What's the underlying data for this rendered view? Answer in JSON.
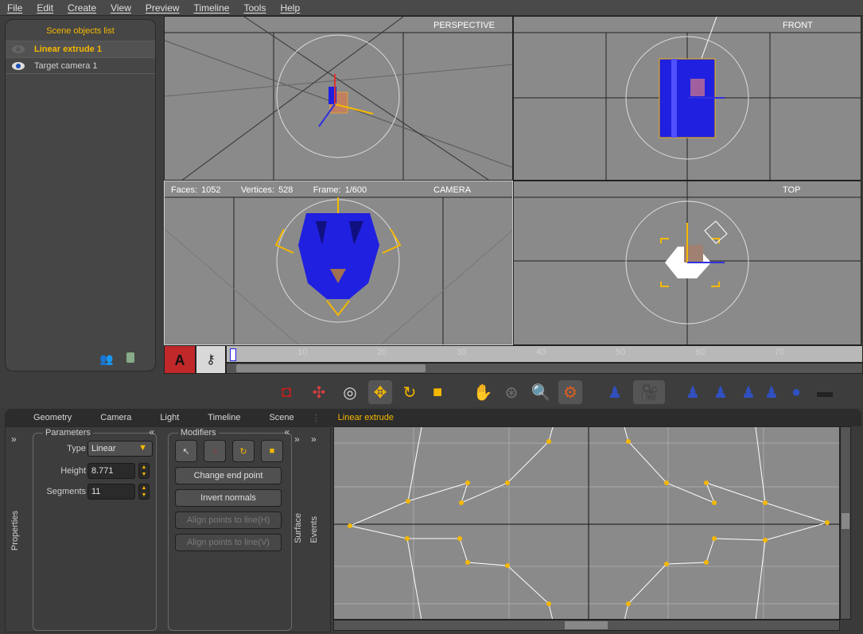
{
  "menu": [
    "File",
    "Edit",
    "Create",
    "View",
    "Preview",
    "Timeline",
    "Tools",
    "Help"
  ],
  "scene_panel": {
    "title": "Scene objects list",
    "objects": [
      {
        "name": "Linear extrude 1",
        "selected": true
      },
      {
        "name": "Target camera 1",
        "selected": false
      }
    ]
  },
  "viewports": {
    "perspective": "PERSPECTIVE",
    "front": "FRONT",
    "camera": "CAMERA",
    "top": "TOP",
    "camera_info": {
      "faces": "Faces: 1052",
      "vertices": "Vertices: 528",
      "frame": "Frame: 1/600"
    }
  },
  "timeline": {
    "ticks": [
      "10",
      "20",
      "30",
      "40",
      "50",
      "60",
      "70"
    ],
    "auto_key_label": "A",
    "key_icon": "key-icon"
  },
  "tabs": [
    {
      "label": "Geometry",
      "active": false
    },
    {
      "label": "Camera",
      "active": false
    },
    {
      "label": "Light",
      "active": false
    },
    {
      "label": "Timeline",
      "active": false
    },
    {
      "label": "Scene",
      "active": false
    },
    {
      "label": "Linear extrude",
      "active": true
    }
  ],
  "parameters": {
    "title": "Parameters",
    "type_label": "Type",
    "type_value": "Linear",
    "height_label": "Height",
    "height_value": "8.771",
    "segments_label": "Segments",
    "segments_value": "11"
  },
  "modifiers": {
    "title": "Modifiers",
    "buttons": [
      {
        "label": "Change end point",
        "enabled": true
      },
      {
        "label": "Invert normals",
        "enabled": true
      },
      {
        "label": "Align points to line(H)",
        "enabled": false
      },
      {
        "label": "Align points to line(V)",
        "enabled": false
      }
    ]
  },
  "side_tabs": {
    "properties": "Properties",
    "surface": "Surface",
    "events": "Events"
  },
  "colors": {
    "accent": "#f5b800",
    "viewport_bg": "#8a8a8a",
    "model_blue": "#2020e0"
  }
}
